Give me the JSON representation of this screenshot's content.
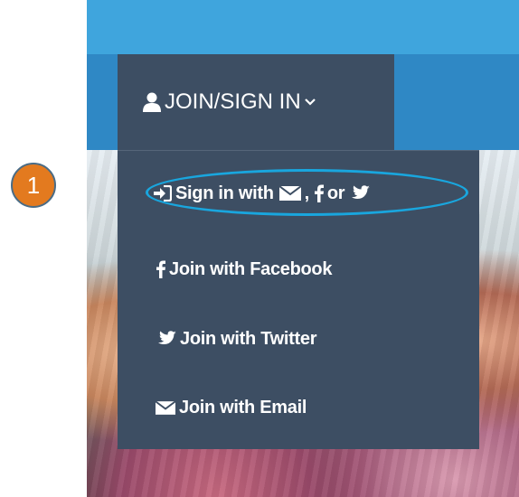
{
  "step_badge": {
    "number": "1"
  },
  "header": {
    "join_tab_label": "JOIN/SIGN IN",
    "user_icon": "user-icon",
    "chevron_icon": "chevron-down-icon"
  },
  "menu": {
    "sign_in": {
      "prefix": "Sign in with",
      "separator": ",",
      "or": "or",
      "icons": [
        "sign-in-icon",
        "envelope-icon",
        "facebook-icon",
        "twitter-icon"
      ]
    },
    "items": [
      {
        "label": "Join with Facebook",
        "icon": "facebook-icon"
      },
      {
        "label": "Join with Twitter",
        "icon": "twitter-icon"
      },
      {
        "label": "Join with Email",
        "icon": "envelope-icon"
      }
    ]
  },
  "colors": {
    "top_bar": "#3fa5dd",
    "nav_bar": "#2f88c5",
    "dropdown": "#3d4e63",
    "highlight": "#19a6de",
    "badge": "#e37a1f"
  }
}
